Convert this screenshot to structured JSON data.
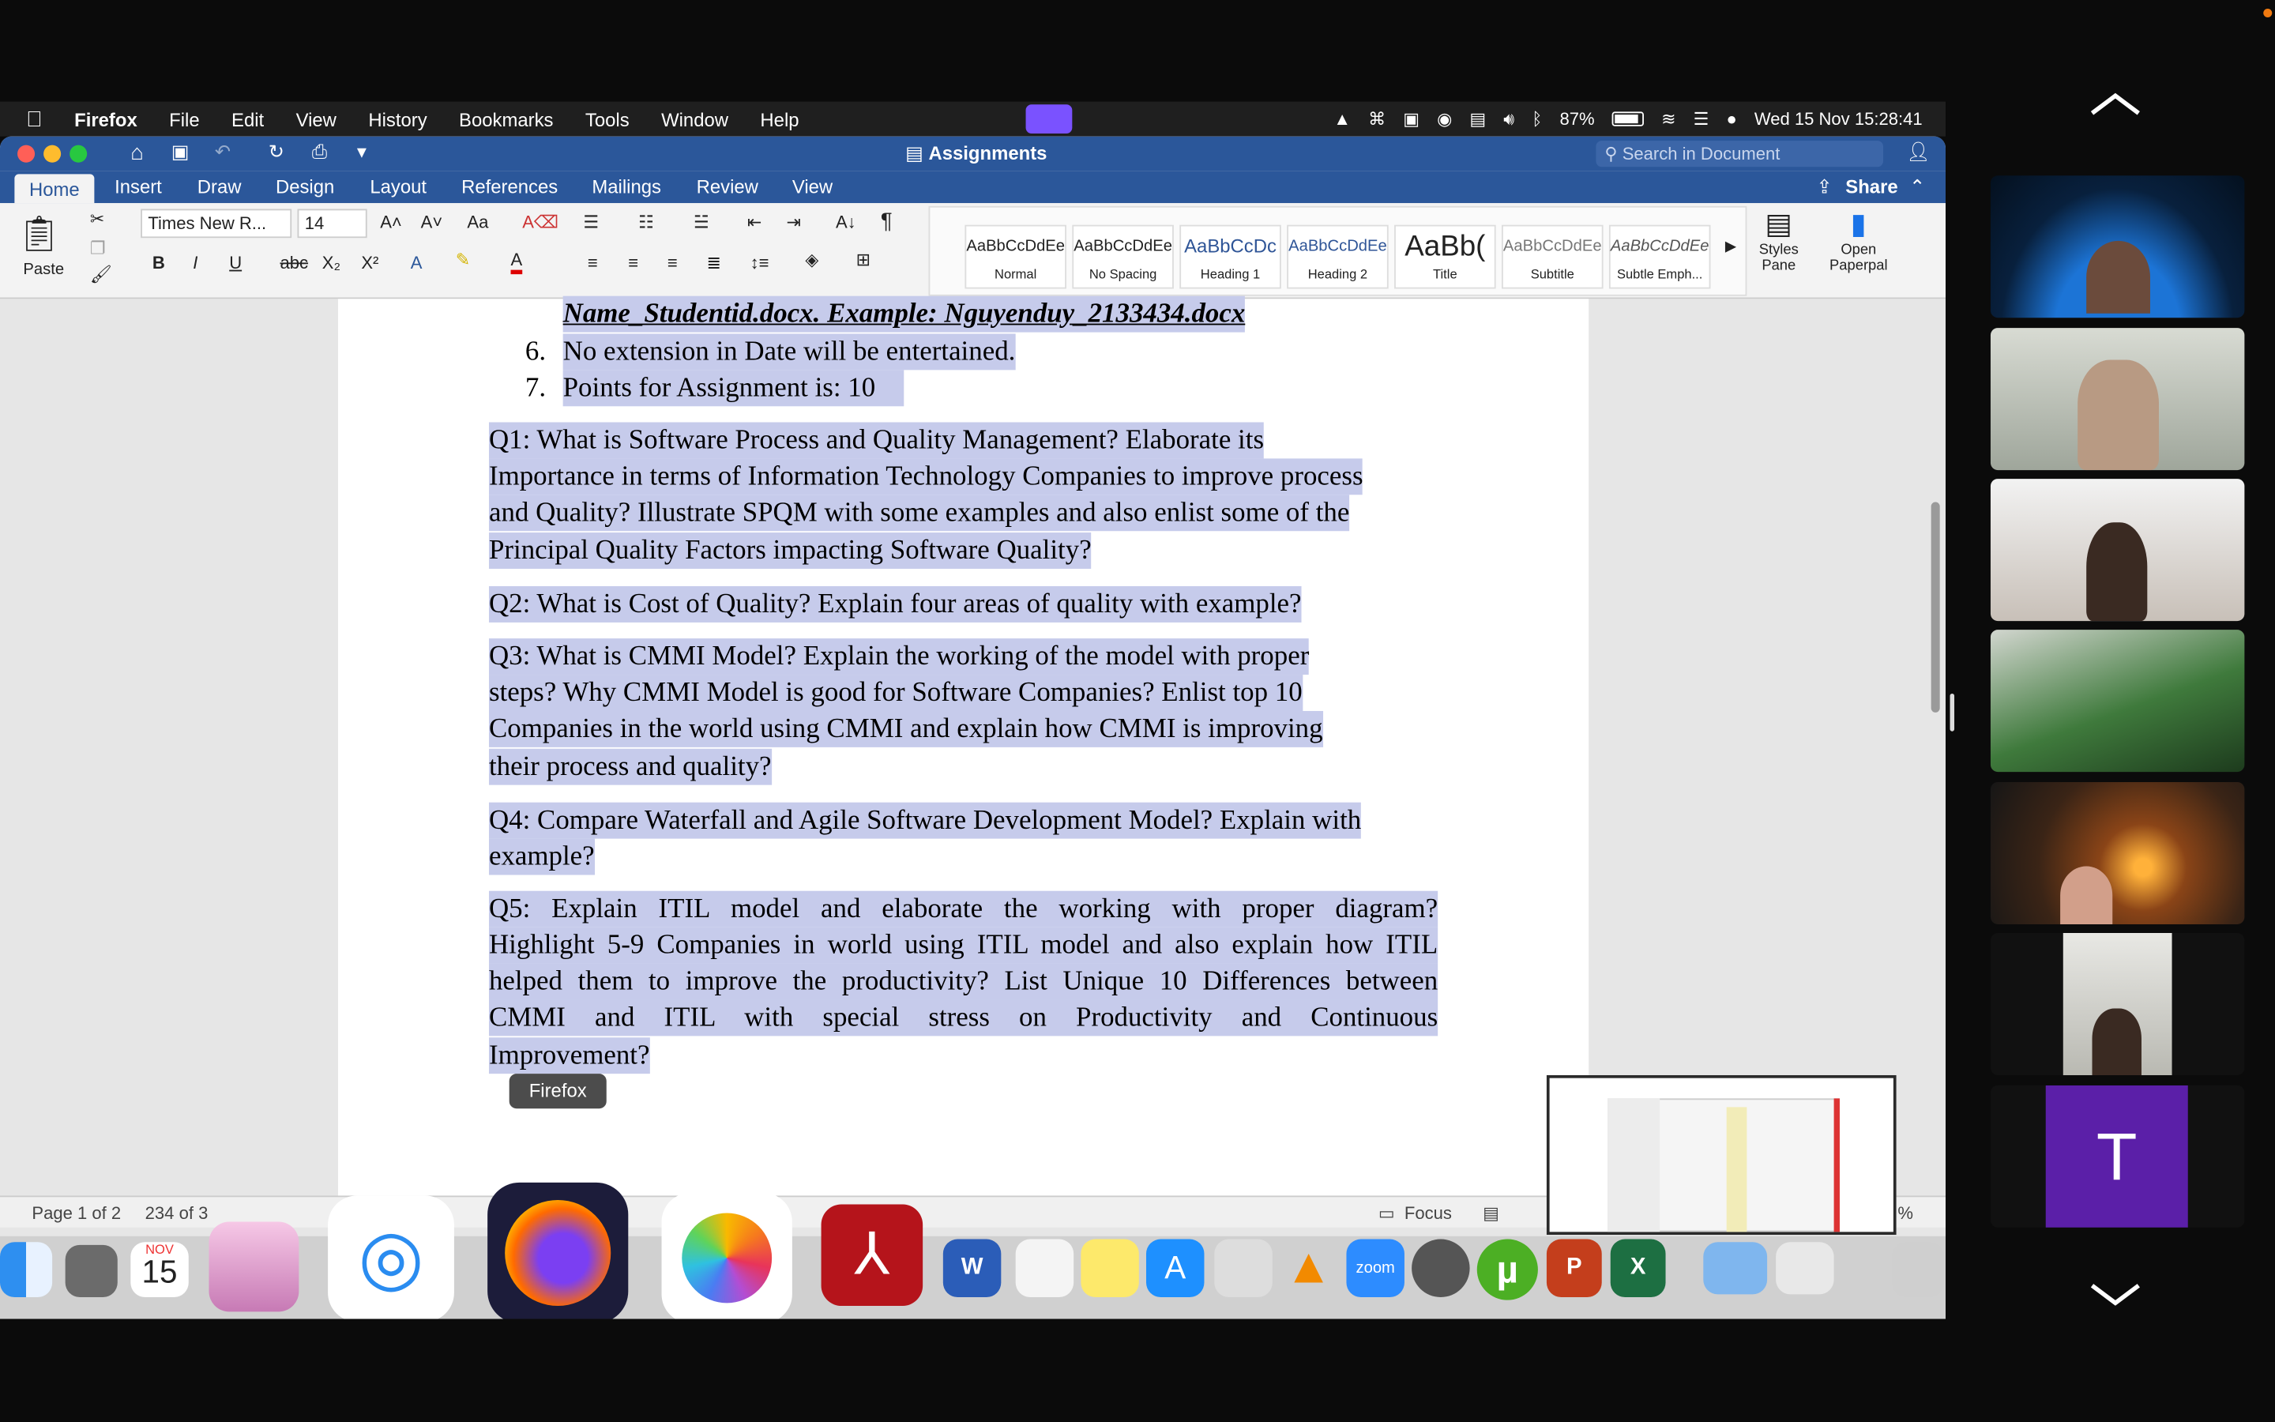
{
  "menubar": {
    "app": "Firefox",
    "items": [
      "File",
      "Edit",
      "View",
      "History",
      "Bookmarks",
      "Tools",
      "Window",
      "Help"
    ],
    "battery": "87%",
    "datetime": "Wed 15 Nov  15:28:41"
  },
  "word": {
    "title": "Assignments",
    "search_placeholder": "Search in Document",
    "share": "Share",
    "tabs": [
      "Home",
      "Insert",
      "Draw",
      "Design",
      "Layout",
      "References",
      "Mailings",
      "Review",
      "View"
    ],
    "font_name": "Times New R...",
    "font_size": "14",
    "paste": "Paste",
    "styles": [
      {
        "preview": "AaBbCcDdEe",
        "name": "Normal"
      },
      {
        "preview": "AaBbCcDdEe",
        "name": "No Spacing"
      },
      {
        "preview": "AaBbCcDc",
        "name": "Heading 1"
      },
      {
        "preview": "AaBbCcDdEe",
        "name": "Heading 2"
      },
      {
        "preview": "AaBb(",
        "name": "Title"
      },
      {
        "preview": "AaBbCcDdEe",
        "name": "Subtitle"
      },
      {
        "preview": "AaBbCcDdEe",
        "name": "Subtle Emph..."
      }
    ],
    "styles_pane": "Styles Pane",
    "open_paperpal": "Open Paperpal",
    "status": {
      "page": "Page 1 of 2",
      "words": "234 of 3",
      "focus": "Focus",
      "zoom": "%"
    }
  },
  "document": {
    "line_filename": "Name_Studentid.docx. Example: Nguyenduy_2133434.docx",
    "item6_num": "6.",
    "item6": "No extension in Date will be entertained.",
    "item7_num": "7.",
    "item7": "Points for Assignment is: 10",
    "q1": [
      "Q1: What is Software Process and Quality Management? Elaborate its",
      "Importance in terms of Information Technology Companies to improve process",
      "and Quality? Illustrate SPQM with some examples and also enlist some of the",
      "Principal Quality Factors impacting Software Quality?"
    ],
    "q2": [
      "Q2: What is Cost of Quality? Explain four areas of quality with example?"
    ],
    "q3": [
      "Q3: What is CMMI Model? Explain the working of the model with proper",
      "steps? Why CMMI Model is good for Software Companies? Enlist top 10",
      "Companies in the world using CMMI and explain how CMMI is improving",
      "their process and quality?"
    ],
    "q4": [
      "Q4: Compare Waterfall and Agile Software Development Model? Explain with",
      "example?"
    ],
    "q5": [
      "Q5: Explain ITIL model and elaborate the working with proper diagram?",
      "Highlight 5-9 Companies in world using ITIL model and also explain how ITIL",
      "helped them to improve the productivity? List Unique 10 Differences between",
      "CMMI and ITIL with special stress on Productivity and Continuous",
      "Improvement?"
    ]
  },
  "dock": {
    "tooltip": "Firefox",
    "calendar_month": "NOV",
    "calendar_day": "15",
    "zoom_label": "zoom"
  },
  "participants": {
    "letter_tile": "T",
    "letter_color": "#5b1fa8"
  }
}
